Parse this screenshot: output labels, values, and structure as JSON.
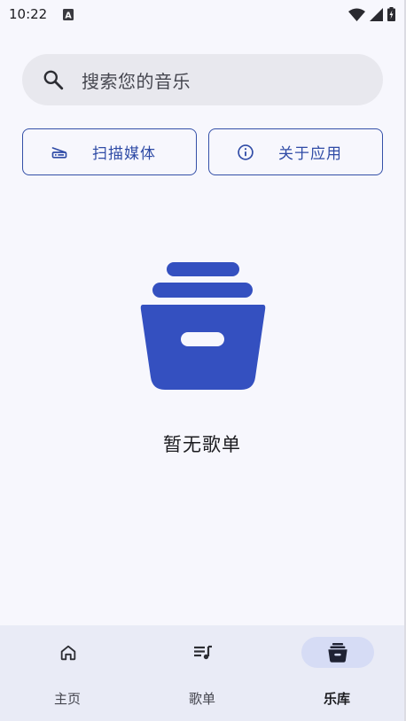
{
  "status_bar": {
    "time": "10:22",
    "notification_icon": "a-letter-icon",
    "icons": [
      "wifi-icon",
      "signal-icon",
      "battery-charging-icon"
    ]
  },
  "search": {
    "placeholder": "搜索您的音乐",
    "icon": "search-icon"
  },
  "actions": {
    "scan_label": "扫描媒体",
    "scan_icon": "scanner-icon",
    "about_label": "关于应用",
    "about_icon": "info-icon"
  },
  "empty_state": {
    "icon": "inventory-box-icon",
    "message": "暂无歌单"
  },
  "bottom_nav": {
    "items": [
      {
        "label": "主页",
        "icon": "home-icon",
        "active": false
      },
      {
        "label": "歌单",
        "icon": "queue-music-icon",
        "active": false
      },
      {
        "label": "乐库",
        "icon": "inventory-icon",
        "active": true
      }
    ]
  },
  "colors": {
    "background": "#f7f7fd",
    "primary": "#3450a8",
    "search_fill": "#e8e8ee",
    "nav_background": "#e9ebf6",
    "nav_active_pill": "#d6dcf5"
  }
}
